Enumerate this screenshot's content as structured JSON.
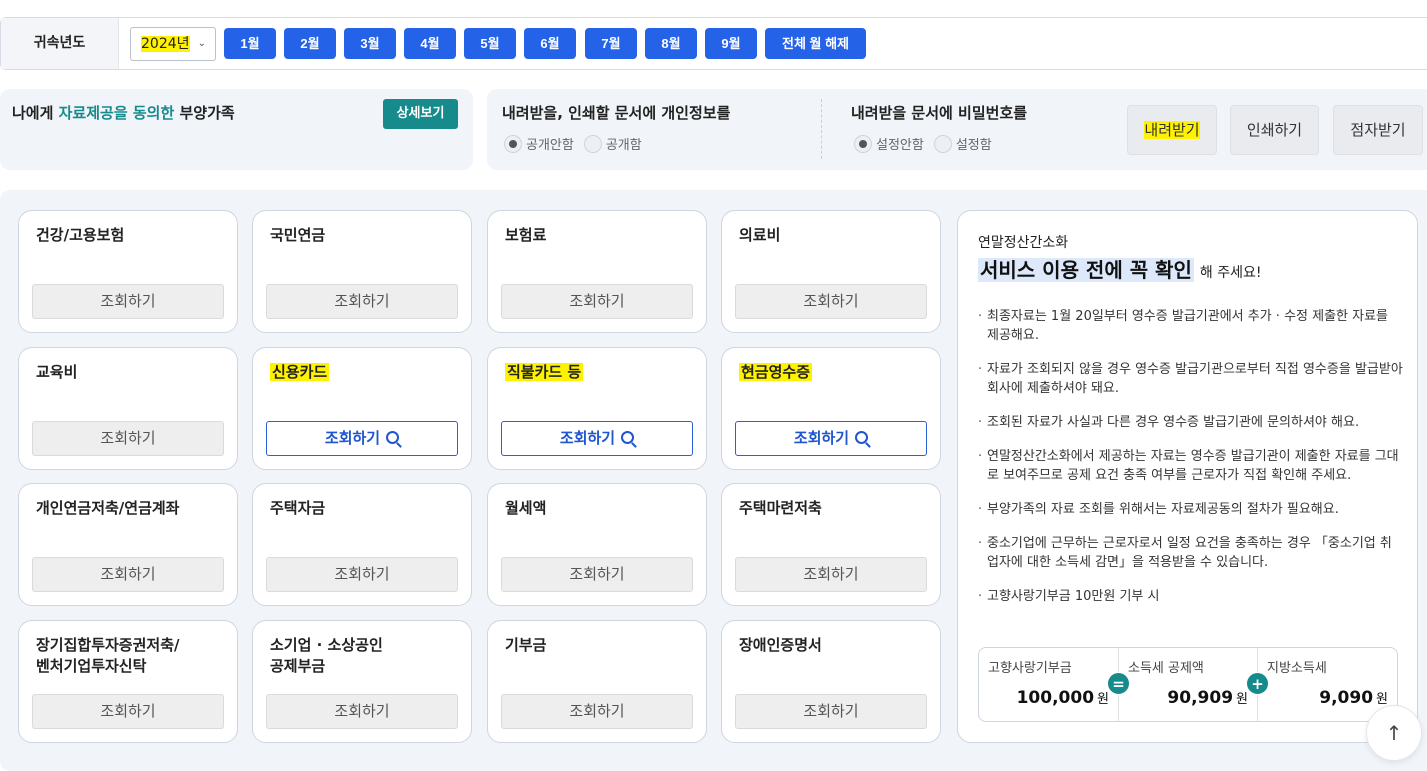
{
  "yearbar": {
    "label": "귀속년도",
    "selected_year": "2024년",
    "months": [
      "1월",
      "2월",
      "3월",
      "4월",
      "5월",
      "6월",
      "7월",
      "8월",
      "9월"
    ],
    "clear_label": "전체 월 해제"
  },
  "consent": {
    "prefix": "나에게 ",
    "highlight": "자료제공을 동의한",
    "suffix": " 부양가족",
    "detail_label": "상세보기"
  },
  "personal_info": {
    "title": "내려받을, 인쇄할 문서에 개인정보를",
    "options": [
      "공개안함",
      "공개함"
    ]
  },
  "password": {
    "title": "내려받을 문서에 비밀번호를",
    "options": [
      "설정안함",
      "설정함"
    ]
  },
  "actions": {
    "download": "내려받기",
    "print": "인쇄하기",
    "braille": "점자받기"
  },
  "cards": [
    {
      "title": "건강/고용보험",
      "button": "조회하기"
    },
    {
      "title": "국민연금",
      "button": "조회하기"
    },
    {
      "title": "보험료",
      "button": "조회하기"
    },
    {
      "title": "의료비",
      "button": "조회하기"
    },
    {
      "title": "교육비",
      "button": "조회하기"
    },
    {
      "title": "신용카드",
      "button": "조회하기"
    },
    {
      "title": "직불카드 등",
      "button": "조회하기"
    },
    {
      "title": "현금영수증",
      "button": "조회하기"
    },
    {
      "title": "개인연금저축/연금계좌",
      "button": "조회하기"
    },
    {
      "title": "주택자금",
      "button": "조회하기"
    },
    {
      "title": "월세액",
      "button": "조회하기"
    },
    {
      "title": "주택마련저축",
      "button": "조회하기"
    },
    {
      "title_line1": "장기집합투자증권저축/",
      "title_line2": "벤처기업투자신탁",
      "button": "조회하기"
    },
    {
      "title_line1": "소기업 · 소상공인",
      "title_line2": "공제부금",
      "button": "조회하기"
    },
    {
      "title": "기부금",
      "button": "조회하기"
    },
    {
      "title": "장애인증명서",
      "button": "조회하기"
    }
  ],
  "info": {
    "subtitle": "연말정산간소화",
    "headline": "서비스 이용 전에 꼭 확인",
    "headline_suffix": "해 주세요!",
    "bullets": [
      "최종자료는 1월 20일부터 영수증 발급기관에서 추가 · 수정 제출한 자료를 제공해요.",
      "자료가 조회되지 않을 경우 영수증 발급기관으로부터 직접 영수증을 발급받아 회사에 제출하셔야 돼요.",
      "조회된 자료가 사실과 다른 경우 영수증 발급기관에 문의하셔야 해요.",
      "연말정산간소화에서 제공하는 자료는 영수증 발급기관이 제출한 자료를 그대로 보여주므로 공제 요건 충족 여부를 근로자가 직접 확인해 주세요.",
      "부양가족의 자료 조회를 위해서는 자료제공동의 절차가 필요해요.",
      "중소기업에 근무하는 근로자로서 일정 요건을 충족하는 경우 「중소기업 취업자에 대한 소득세 감면」을 적용받을 수 있습니다.",
      "고향사랑기부금 10만원 기부 시"
    ],
    "calc": {
      "col1_label": "고향사랑기부금",
      "col1_value": "100,000",
      "col2_label": "소득세 공제액",
      "col2_value": "90,909",
      "col3_label": "지방소득세",
      "col3_value": "9,090",
      "unit": "원",
      "op1": "=",
      "op2": "+"
    }
  },
  "colors": {
    "primary_blue": "#2463e8",
    "teal": "#178a8c",
    "highlight_yellow": "#fff200",
    "panel_bg": "#f1f4f9"
  },
  "scroll_top_icon": "↑"
}
